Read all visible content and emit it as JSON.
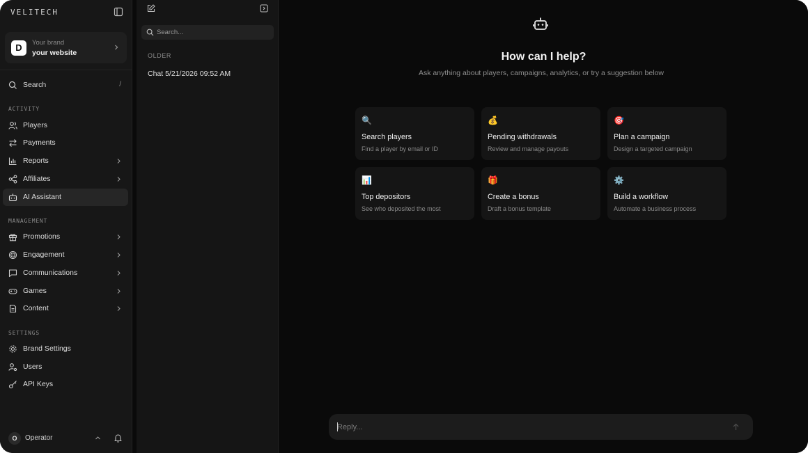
{
  "sidebar": {
    "logo": "VELITECH",
    "brand": {
      "avatar_letter": "D",
      "top_label": "Your brand",
      "name": "your website"
    },
    "search": {
      "label": "Search",
      "shortcut": "/"
    },
    "sections": {
      "activity": "ACTIVITY",
      "management": "MANAGEMENT",
      "settings": "SETTINGS"
    },
    "items": {
      "players": "Players",
      "payments": "Payments",
      "reports": "Reports",
      "affiliates": "Affiliates",
      "ai_assistant": "AI Assistant",
      "promotions": "Promotions",
      "engagement": "Engagement",
      "communications": "Communications",
      "games": "Games",
      "content": "Content",
      "brand_settings": "Brand Settings",
      "users": "Users",
      "api_keys": "API Keys"
    },
    "operator": {
      "avatar_letter": "O",
      "label": "Operator"
    }
  },
  "chatlist": {
    "search_placeholder": "Search...",
    "group_label": "OLDER",
    "chats": [
      "Chat 5/21/2026 09:52 AM"
    ]
  },
  "main": {
    "title": "How can I help?",
    "subtitle": "Ask anything about players, campaigns, analytics, or try a suggestion below",
    "suggestions": [
      {
        "emoji": "🔍",
        "title": "Search players",
        "desc": "Find a player by email or ID"
      },
      {
        "emoji": "💰",
        "title": "Pending withdrawals",
        "desc": "Review and manage payouts"
      },
      {
        "emoji": "🎯",
        "title": "Plan a campaign",
        "desc": "Design a targeted campaign"
      },
      {
        "emoji": "📊",
        "title": "Top depositors",
        "desc": "See who deposited the most"
      },
      {
        "emoji": "🎁",
        "title": "Create a bonus",
        "desc": "Draft a bonus template"
      },
      {
        "emoji": "⚙️",
        "title": "Build a workflow",
        "desc": "Automate a business process"
      }
    ],
    "reply_placeholder": "Reply..."
  },
  "colors": {
    "background": "#0a0a0a",
    "sidebar": "#171717",
    "panel": "#151515",
    "active_item": "#262626",
    "text": "#e6e6e6",
    "muted": "#8a8a8a"
  }
}
